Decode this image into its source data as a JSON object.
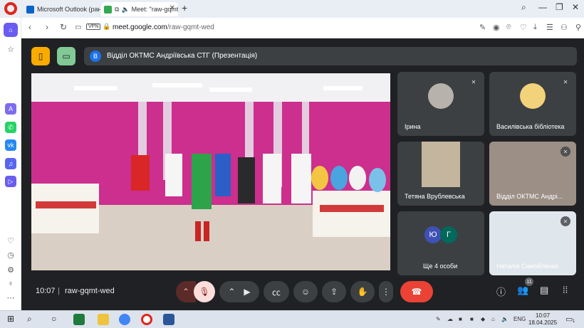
{
  "browser": {
    "tabs": [
      {
        "title": "Microsoft Outlook (ранiш"
      },
      {
        "title": "Meet: \"raw-gqmt-we"
      }
    ],
    "address": {
      "vpn_label": "VPN",
      "domain": "meet.google.com",
      "path": "/raw-gqmt-wed"
    }
  },
  "meet": {
    "presenter": {
      "initial": "В",
      "title": "Відділ ОКТМС Андріївська СТГ (Презентація)"
    },
    "participants": [
      {
        "name": "Ірина",
        "muted": true
      },
      {
        "name": "Василівська бібліотека",
        "muted": true
      },
      {
        "name": "Тетяна Врублевська",
        "muted": false
      },
      {
        "name": "Відділ ОКТМС Андрі...",
        "muted": true
      },
      {
        "name": "Ще 4 особи",
        "initials": [
          "Ю",
          "Г"
        ]
      },
      {
        "name": "Наталія Самойленко",
        "muted": true
      }
    ],
    "time": "10:07",
    "separator": "|",
    "code": "raw-gqmt-wed",
    "people_count": "11",
    "colors": {
      "end_call": "#ea4335",
      "mic_off_bg": "#f9dedc",
      "tile_bg": "#3c4043"
    }
  },
  "taskbar": {
    "language": "ENG",
    "time": "10:07",
    "date": "18.04.2025",
    "notification_count": "1"
  }
}
